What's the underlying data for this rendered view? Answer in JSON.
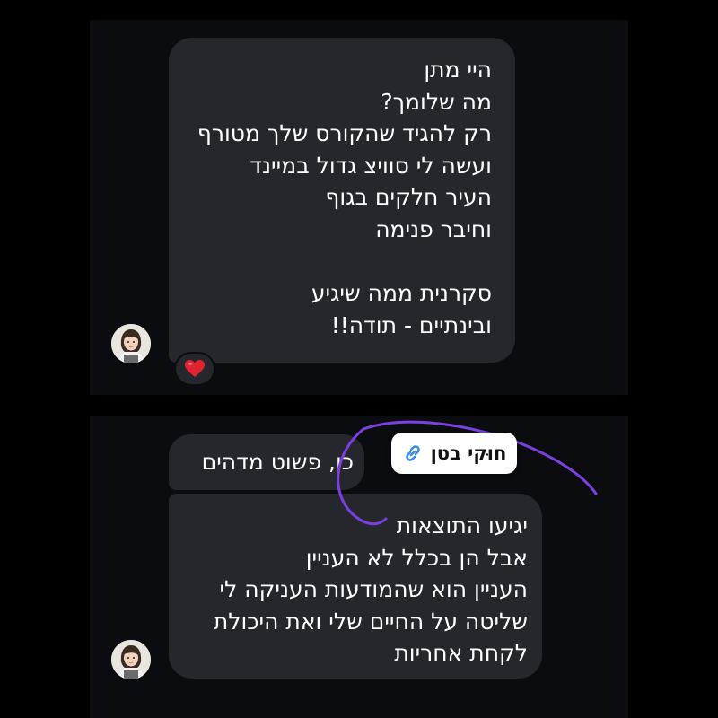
{
  "messages": [
    {
      "lines": [
        "היי מתן",
        "מה שלומך?",
        "רק להגיד שהקורס שלך מטורף",
        "ועשה לי סוויצ גדול במיינד",
        "העיר חלקים בגוף",
        "וחיבר פנימה",
        "",
        "סקרנית ממה שיגיע",
        "ובינתיים - תודה!!"
      ],
      "reaction": "❤️"
    },
    {
      "lines": [
        "כן, פשוט מדהים"
      ]
    },
    {
      "lines": [
        "יגיעו התוצאות",
        "אבל הן בכלל לא העניין",
        "העניין הוא שהמודעות העניקה לי",
        "שליטה על החיים שלי ואת היכולת",
        "לקחת אחריות"
      ]
    }
  ],
  "tag": {
    "label": "חוּקי בטן",
    "icon": "link-icon"
  },
  "colors": {
    "bubble": "#26272d",
    "background": "#0b0c10",
    "scribble": "#7b3fe4"
  }
}
